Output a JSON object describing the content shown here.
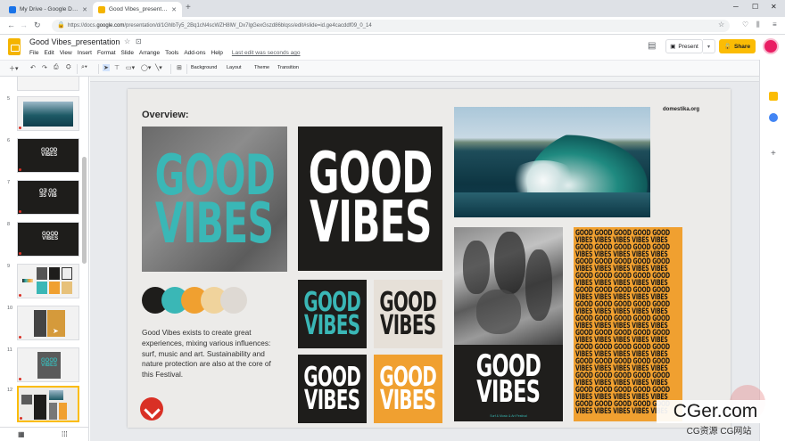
{
  "browser": {
    "tabs": [
      {
        "label": "My Drive - Google Drive",
        "favicon_color": "#1a73e8"
      },
      {
        "label": "Good Vibes_presentation - Google Slides",
        "favicon_color": "#f4b400"
      }
    ],
    "new_tab_label": "+",
    "url_prefix": "https://docs.",
    "url_domain": "google.com",
    "url_rest": "/presentation/d/1GhlbTy5_2Bq1cN4scWZH8lW_Dx7lgGexGszd86blqss/edit#slide=id.ge4cacddf09_0_14"
  },
  "docs": {
    "title": "Good Vibes_presentation",
    "menu": [
      "File",
      "Edit",
      "View",
      "Insert",
      "Format",
      "Slide",
      "Arrange",
      "Tools",
      "Add-ons",
      "Help"
    ],
    "last_edit": "Last edit was seconds ago",
    "present_label": "Present",
    "share_label": "Share",
    "share_color": "#fbbc04",
    "toolbar": {
      "background": "Background",
      "layout": "Layout",
      "theme": "Theme",
      "transition": "Transition"
    }
  },
  "filmstrip": {
    "slides": [
      {
        "number": "5",
        "kind": "wave"
      },
      {
        "number": "6",
        "kind": "dark"
      },
      {
        "number": "7",
        "kind": "dark2"
      },
      {
        "number": "8",
        "kind": "dark3"
      },
      {
        "number": "9",
        "kind": "palette"
      },
      {
        "number": "10",
        "kind": "collage"
      },
      {
        "number": "11",
        "kind": "teal"
      },
      {
        "number": "12",
        "kind": "overview",
        "selected": true
      }
    ]
  },
  "slide": {
    "heading": "Overview:",
    "brand": "domestika.org",
    "description": "Good Vibes exists to create great experiences, mixing various influences: surf, music and art. Sustainability and nature protection are also at the core of this Festival.",
    "poster_word1": "GOOD",
    "poster_word2": "VIBES",
    "tagline": "Surf & Music & Art Festival",
    "palette": [
      "#1e1d1b",
      "#3ab7b6",
      "#f0a030",
      "#f0d39c",
      "#ded9d3"
    ],
    "colors": {
      "teal": "#3ab7b6",
      "orange": "#f0a030",
      "black": "#1e1d1b",
      "cream": "#e6e0d8"
    }
  },
  "watermark": {
    "main": "CGer.com",
    "sub": "CG资源 CG网站"
  }
}
